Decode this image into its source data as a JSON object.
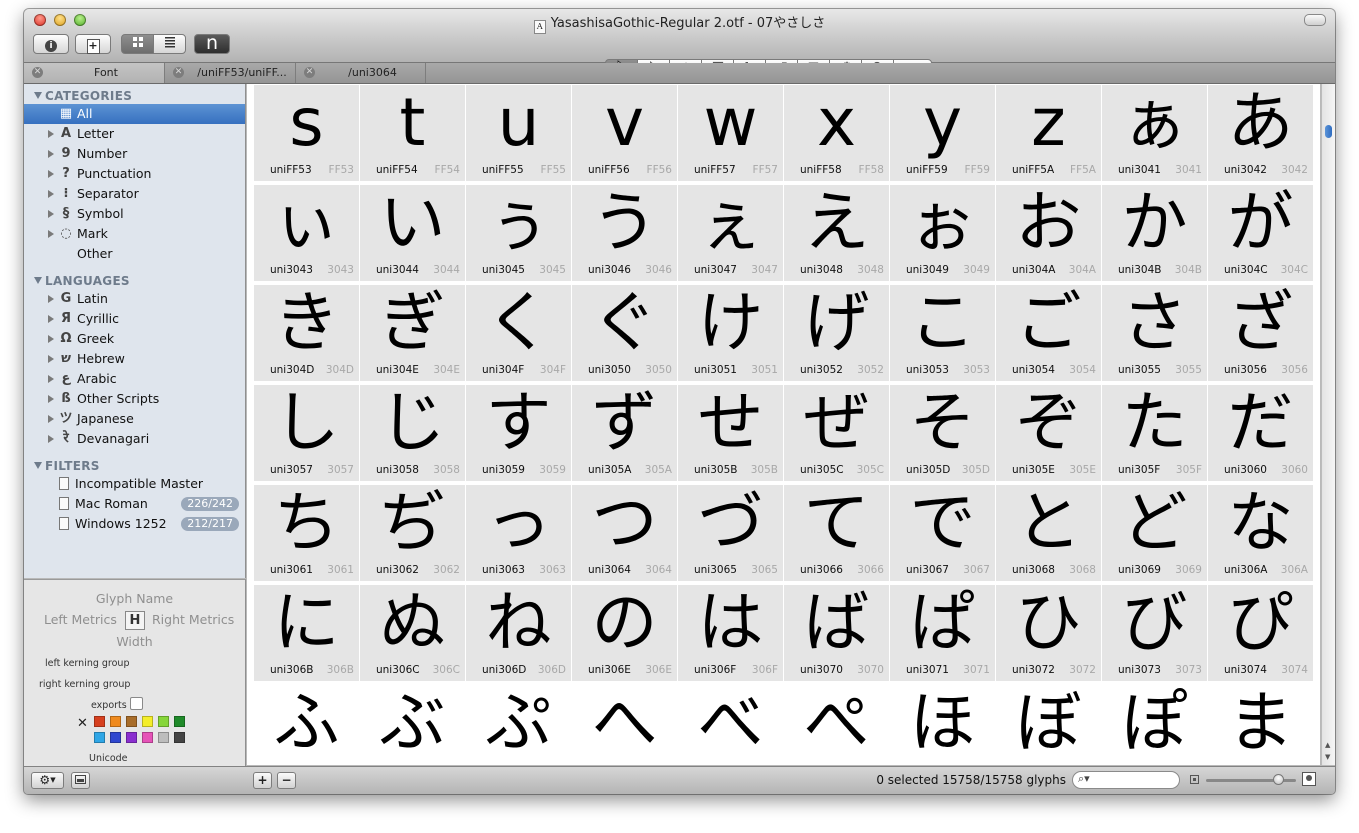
{
  "window": {
    "title": "YasashisaGothic-Regular 2.otf - 07やさしさ",
    "doc_icon": "A"
  },
  "toolbar": {
    "info_icon": "i",
    "add_icon": "+",
    "view_grid_icon": "grid-view",
    "view_list_icon": "list-view",
    "preview_label": "n",
    "tools": [
      "select-tool",
      "select-all-layers-tool",
      "eraser-tool",
      "rectangle-tool",
      "rotate-tool",
      "scale-tool",
      "text-tool",
      "hand-tool",
      "zoom-tool",
      "measure-tool"
    ]
  },
  "tabs": [
    {
      "label": "Font"
    },
    {
      "label": "/uniFF53/uniFF..."
    },
    {
      "label": "/uni3064"
    }
  ],
  "sidebar": {
    "categories_header": "CATEGORIES",
    "categories": [
      {
        "icon": "▦",
        "label": "All",
        "selected": true
      },
      {
        "icon": "A",
        "label": "Letter"
      },
      {
        "icon": "9",
        "label": "Number"
      },
      {
        "icon": "?",
        "label": "Punctuation"
      },
      {
        "icon": "⁝",
        "label": "Separator"
      },
      {
        "icon": "§",
        "label": "Symbol"
      },
      {
        "icon": "◌",
        "label": "Mark"
      },
      {
        "icon": "",
        "label": "Other"
      }
    ],
    "languages_header": "LANGUAGES",
    "languages": [
      {
        "icon": "G",
        "label": "Latin"
      },
      {
        "icon": "Я",
        "label": "Cyrillic"
      },
      {
        "icon": "Ω",
        "label": "Greek"
      },
      {
        "icon": "ש",
        "label": "Hebrew"
      },
      {
        "icon": "ع",
        "label": "Arabic"
      },
      {
        "icon": "ß",
        "label": "Other Scripts"
      },
      {
        "icon": "ツ",
        "label": "Japanese"
      },
      {
        "icon": "रे",
        "label": "Devanagari"
      }
    ],
    "filters_header": "FILTERS",
    "filters": [
      {
        "label": "Incompatible Master",
        "badge": ""
      },
      {
        "label": "Mac Roman",
        "badge": "226/242"
      },
      {
        "label": "Windows 1252",
        "badge": "212/217"
      }
    ]
  },
  "glyph_info": {
    "glyph_name": "Glyph Name",
    "left_metrics": "Left Metrics",
    "right_metrics": "Right Metrics",
    "width": "Width",
    "left_kerning_group": "left kerning group",
    "right_kerning_group": "right kerning group",
    "exports": "exports",
    "unicode": "Unicode",
    "clear_icon": "✕",
    "color_swatches": [
      "#d6401f",
      "#ef8a1e",
      "#a86d2a",
      "#f4ee2a",
      "#86d63a",
      "#1f8a2a",
      "#2fa6e6",
      "#2f47cf",
      "#8a2fcf",
      "#e653b8",
      "#bdbdbd",
      "#444444"
    ]
  },
  "glyph_grid": [
    {
      "char": "s",
      "name": "uniFF53",
      "code": "FF53"
    },
    {
      "char": "t",
      "name": "uniFF54",
      "code": "FF54"
    },
    {
      "char": "u",
      "name": "uniFF55",
      "code": "FF55"
    },
    {
      "char": "v",
      "name": "uniFF56",
      "code": "FF56"
    },
    {
      "char": "w",
      "name": "uniFF57",
      "code": "FF57"
    },
    {
      "char": "x",
      "name": "uniFF58",
      "code": "FF58"
    },
    {
      "char": "y",
      "name": "uniFF59",
      "code": "FF59"
    },
    {
      "char": "z",
      "name": "uniFF5A",
      "code": "FF5A"
    },
    {
      "char": "ぁ",
      "name": "uni3041",
      "code": "3041"
    },
    {
      "char": "あ",
      "name": "uni3042",
      "code": "3042"
    },
    {
      "char": "ぃ",
      "name": "uni3043",
      "code": "3043"
    },
    {
      "char": "い",
      "name": "uni3044",
      "code": "3044"
    },
    {
      "char": "ぅ",
      "name": "uni3045",
      "code": "3045"
    },
    {
      "char": "う",
      "name": "uni3046",
      "code": "3046"
    },
    {
      "char": "ぇ",
      "name": "uni3047",
      "code": "3047"
    },
    {
      "char": "え",
      "name": "uni3048",
      "code": "3048"
    },
    {
      "char": "ぉ",
      "name": "uni3049",
      "code": "3049"
    },
    {
      "char": "お",
      "name": "uni304A",
      "code": "304A"
    },
    {
      "char": "か",
      "name": "uni304B",
      "code": "304B"
    },
    {
      "char": "が",
      "name": "uni304C",
      "code": "304C"
    },
    {
      "char": "き",
      "name": "uni304D",
      "code": "304D"
    },
    {
      "char": "ぎ",
      "name": "uni304E",
      "code": "304E"
    },
    {
      "char": "く",
      "name": "uni304F",
      "code": "304F"
    },
    {
      "char": "ぐ",
      "name": "uni3050",
      "code": "3050"
    },
    {
      "char": "け",
      "name": "uni3051",
      "code": "3051"
    },
    {
      "char": "げ",
      "name": "uni3052",
      "code": "3052"
    },
    {
      "char": "こ",
      "name": "uni3053",
      "code": "3053"
    },
    {
      "char": "ご",
      "name": "uni3054",
      "code": "3054"
    },
    {
      "char": "さ",
      "name": "uni3055",
      "code": "3055"
    },
    {
      "char": "ざ",
      "name": "uni3056",
      "code": "3056"
    },
    {
      "char": "し",
      "name": "uni3057",
      "code": "3057"
    },
    {
      "char": "じ",
      "name": "uni3058",
      "code": "3058"
    },
    {
      "char": "す",
      "name": "uni3059",
      "code": "3059"
    },
    {
      "char": "ず",
      "name": "uni305A",
      "code": "305A"
    },
    {
      "char": "せ",
      "name": "uni305B",
      "code": "305B"
    },
    {
      "char": "ぜ",
      "name": "uni305C",
      "code": "305C"
    },
    {
      "char": "そ",
      "name": "uni305D",
      "code": "305D"
    },
    {
      "char": "ぞ",
      "name": "uni305E",
      "code": "305E"
    },
    {
      "char": "た",
      "name": "uni305F",
      "code": "305F"
    },
    {
      "char": "だ",
      "name": "uni3060",
      "code": "3060"
    },
    {
      "char": "ち",
      "name": "uni3061",
      "code": "3061"
    },
    {
      "char": "ぢ",
      "name": "uni3062",
      "code": "3062"
    },
    {
      "char": "っ",
      "name": "uni3063",
      "code": "3063"
    },
    {
      "char": "つ",
      "name": "uni3064",
      "code": "3064"
    },
    {
      "char": "づ",
      "name": "uni3065",
      "code": "3065"
    },
    {
      "char": "て",
      "name": "uni3066",
      "code": "3066"
    },
    {
      "char": "で",
      "name": "uni3067",
      "code": "3067"
    },
    {
      "char": "と",
      "name": "uni3068",
      "code": "3068"
    },
    {
      "char": "ど",
      "name": "uni3069",
      "code": "3069"
    },
    {
      "char": "な",
      "name": "uni306A",
      "code": "306A"
    },
    {
      "char": "に",
      "name": "uni306B",
      "code": "306B"
    },
    {
      "char": "ぬ",
      "name": "uni306C",
      "code": "306C"
    },
    {
      "char": "ね",
      "name": "uni306D",
      "code": "306D"
    },
    {
      "char": "の",
      "name": "uni306E",
      "code": "306E"
    },
    {
      "char": "は",
      "name": "uni306F",
      "code": "306F"
    },
    {
      "char": "ば",
      "name": "uni3070",
      "code": "3070"
    },
    {
      "char": "ぱ",
      "name": "uni3071",
      "code": "3071"
    },
    {
      "char": "ひ",
      "name": "uni3072",
      "code": "3072"
    },
    {
      "char": "び",
      "name": "uni3073",
      "code": "3073"
    },
    {
      "char": "ぴ",
      "name": "uni3074",
      "code": "3074"
    },
    {
      "char": "ふ",
      "name": "",
      "code": ""
    },
    {
      "char": "ぶ",
      "name": "",
      "code": ""
    },
    {
      "char": "ぷ",
      "name": "",
      "code": ""
    },
    {
      "char": "へ",
      "name": "",
      "code": ""
    },
    {
      "char": "べ",
      "name": "",
      "code": ""
    },
    {
      "char": "ぺ",
      "name": "",
      "code": ""
    },
    {
      "char": "ほ",
      "name": "",
      "code": ""
    },
    {
      "char": "ぼ",
      "name": "",
      "code": ""
    },
    {
      "char": "ぽ",
      "name": "",
      "code": ""
    },
    {
      "char": "ま",
      "name": "",
      "code": ""
    }
  ],
  "bottombar": {
    "action_icon": "gear-icon",
    "panel_icon": "panel-icon",
    "add_label": "+",
    "remove_label": "−",
    "status": "0 selected 15758/15758 glyphs",
    "search_placeholder": "",
    "zoom_level": 0.85
  }
}
